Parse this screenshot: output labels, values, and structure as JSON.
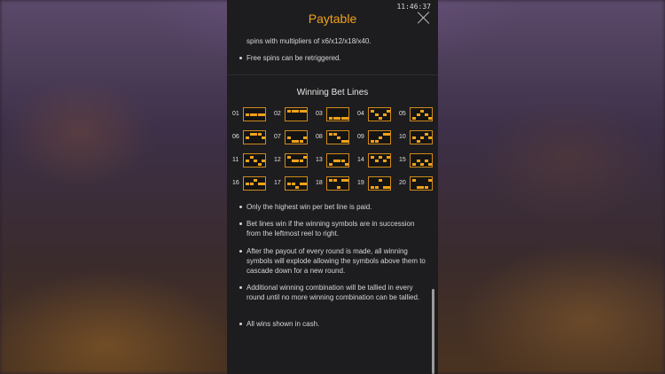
{
  "clock": "11:46:37",
  "header": {
    "title": "Paytable"
  },
  "top": {
    "continued_text": "spins with multipliers of x6/x12/x18/x40.",
    "retrigger_text": "Free spins can be retriggered."
  },
  "section": {
    "title": "Winning Bet Lines"
  },
  "bet_lines": [
    {
      "num": "01",
      "rows": [
        1,
        1,
        1,
        1,
        1
      ]
    },
    {
      "num": "02",
      "rows": [
        0,
        0,
        0,
        0,
        0
      ]
    },
    {
      "num": "03",
      "rows": [
        2,
        2,
        2,
        2,
        2
      ]
    },
    {
      "num": "04",
      "rows": [
        0,
        1,
        2,
        1,
        0
      ]
    },
    {
      "num": "05",
      "rows": [
        2,
        1,
        0,
        1,
        2
      ]
    },
    {
      "num": "06",
      "rows": [
        1,
        0,
        0,
        0,
        1
      ]
    },
    {
      "num": "07",
      "rows": [
        1,
        2,
        2,
        2,
        1
      ]
    },
    {
      "num": "08",
      "rows": [
        0,
        0,
        1,
        2,
        2
      ]
    },
    {
      "num": "09",
      "rows": [
        2,
        2,
        1,
        0,
        0
      ]
    },
    {
      "num": "10",
      "rows": [
        1,
        2,
        1,
        0,
        1
      ]
    },
    {
      "num": "11",
      "rows": [
        1,
        0,
        1,
        2,
        1
      ]
    },
    {
      "num": "12",
      "rows": [
        0,
        1,
        1,
        1,
        0
      ]
    },
    {
      "num": "13",
      "rows": [
        2,
        1,
        1,
        1,
        2
      ]
    },
    {
      "num": "14",
      "rows": [
        0,
        1,
        0,
        1,
        0
      ]
    },
    {
      "num": "15",
      "rows": [
        2,
        1,
        2,
        1,
        2
      ]
    },
    {
      "num": "16",
      "rows": [
        1,
        1,
        0,
        1,
        1
      ]
    },
    {
      "num": "17",
      "rows": [
        1,
        1,
        2,
        1,
        1
      ]
    },
    {
      "num": "18",
      "rows": [
        0,
        0,
        2,
        0,
        0
      ]
    },
    {
      "num": "19",
      "rows": [
        2,
        2,
        0,
        2,
        2
      ]
    },
    {
      "num": "20",
      "rows": [
        0,
        2,
        2,
        2,
        0
      ]
    }
  ],
  "rules": [
    "Only the highest win per bet line is paid.",
    "Bet lines win if the winning symbols are in succession from the leftmost reel to right.",
    "After the payout of every round is made, all winning symbols will explode allowing the symbols above them to cascade down for a new round.",
    "Additional winning combination will be tallied in every round until no more winning combination can be tallied.",
    "All wins shown in cash."
  ],
  "colors": {
    "accent": "#f0a21a",
    "panel": "#1d1d1f"
  }
}
